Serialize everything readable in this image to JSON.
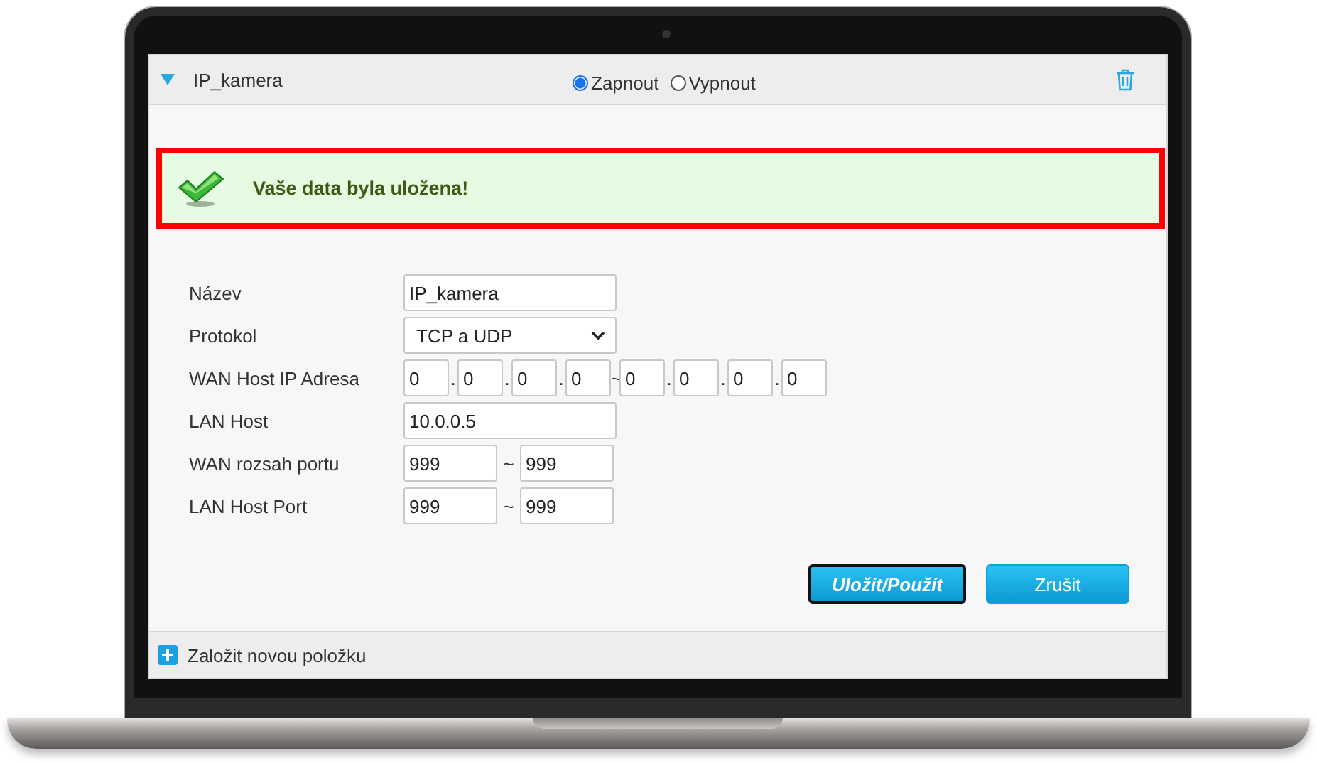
{
  "entry": {
    "name": "IP_kamera",
    "expanded": true,
    "state_options": [
      {
        "label": "Zapnout",
        "selected": true
      },
      {
        "label": "Vypnout",
        "selected": false
      }
    ]
  },
  "message": {
    "text": "Vaše data byla uložena!"
  },
  "form": {
    "fields": [
      {
        "kind": "text",
        "label": "Název",
        "value": "IP_kamera"
      },
      {
        "kind": "select",
        "label": "Protokol",
        "value": "TCP a UDP"
      },
      {
        "kind": "ip_range",
        "label": "WAN Host IP Adresa",
        "octets": [
          "0",
          "0",
          "0",
          "0",
          "0",
          "0",
          "0",
          "0"
        ],
        "separators": [
          ".",
          ".",
          ".",
          "~",
          ".",
          ".",
          "."
        ]
      },
      {
        "kind": "text",
        "label": "LAN Host",
        "value": "10.0.0.5"
      },
      {
        "kind": "port_range",
        "label": "WAN rozsah portu",
        "from": "999",
        "separator": "~",
        "to": "999"
      },
      {
        "kind": "port_range",
        "label": "LAN Host Port",
        "from": "999",
        "separator": "~",
        "to": "999"
      }
    ]
  },
  "buttons": [
    {
      "label": "Uložit/Použít",
      "focused": true
    },
    {
      "label": "Zrušit",
      "focused": false
    }
  ],
  "add_item": {
    "label": "Založit novou položku"
  }
}
